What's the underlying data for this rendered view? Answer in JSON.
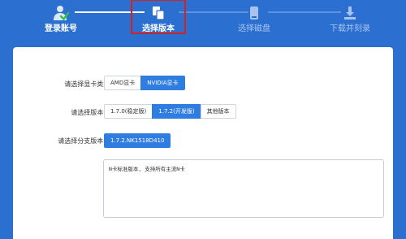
{
  "steps": [
    {
      "label": "登录账号",
      "state": "done"
    },
    {
      "label": "选择版本",
      "state": "current"
    },
    {
      "label": "选择磁盘",
      "state": "upcoming"
    },
    {
      "label": "下载并刻录",
      "state": "upcoming"
    }
  ],
  "form": {
    "gpu_type": {
      "label": "请选择显卡类型:",
      "options": [
        "AMD显卡",
        "NVIDIA显卡"
      ],
      "selected": "NVIDIA显卡"
    },
    "version": {
      "label": "请选择版本号:",
      "options": [
        "1.7.0(稳定版)",
        "1.7.2(开发版)",
        "其他版本"
      ],
      "selected": "1.7.2(开发版)"
    },
    "branch": {
      "label": "请选择分支版本号:",
      "value": "1.7.2.NK1518D410"
    },
    "description": "N卡标准版本, 支持所有主流N卡"
  },
  "colors": {
    "background": "#2b6fd0",
    "accent": "#2f7de1",
    "highlight_box": "#d8201f"
  }
}
